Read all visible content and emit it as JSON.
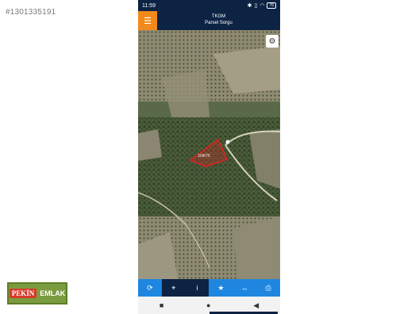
{
  "listing": {
    "id": "#1301335191"
  },
  "status_bar": {
    "time": "11:59",
    "battery": "76",
    "icons": [
      "bluetooth-icon",
      "vibrate-icon",
      "wifi-icon",
      "battery-icon"
    ]
  },
  "app_bar": {
    "title": "TKGM",
    "subtitle": "Parsel Sorgu",
    "menu_icon": "hamburger-menu-icon",
    "accent": "#f28a1b",
    "bg": "#0d2344"
  },
  "map": {
    "parcel_label": "104/70",
    "settings_icon": "gear-icon",
    "parcel_color": "#e02020"
  },
  "toolbar": {
    "bg": "#1f86e0",
    "items": [
      {
        "icon": "refresh-icon",
        "glyph": "⟳"
      },
      {
        "icon": "locate-icon",
        "glyph": "⌖"
      },
      {
        "icon": "info-icon",
        "glyph": "i"
      },
      {
        "icon": "star-icon",
        "glyph": "★"
      },
      {
        "icon": "measure-icon",
        "glyph": "↔"
      },
      {
        "icon": "print-icon",
        "glyph": "⎙"
      }
    ]
  },
  "nav_bar": {
    "items": [
      {
        "icon": "recents-icon",
        "glyph": "■"
      },
      {
        "icon": "home-icon",
        "glyph": "●"
      },
      {
        "icon": "back-icon",
        "glyph": "◀"
      }
    ]
  },
  "logo": {
    "word1": "PEKİN",
    "word2": "EMLAK"
  }
}
